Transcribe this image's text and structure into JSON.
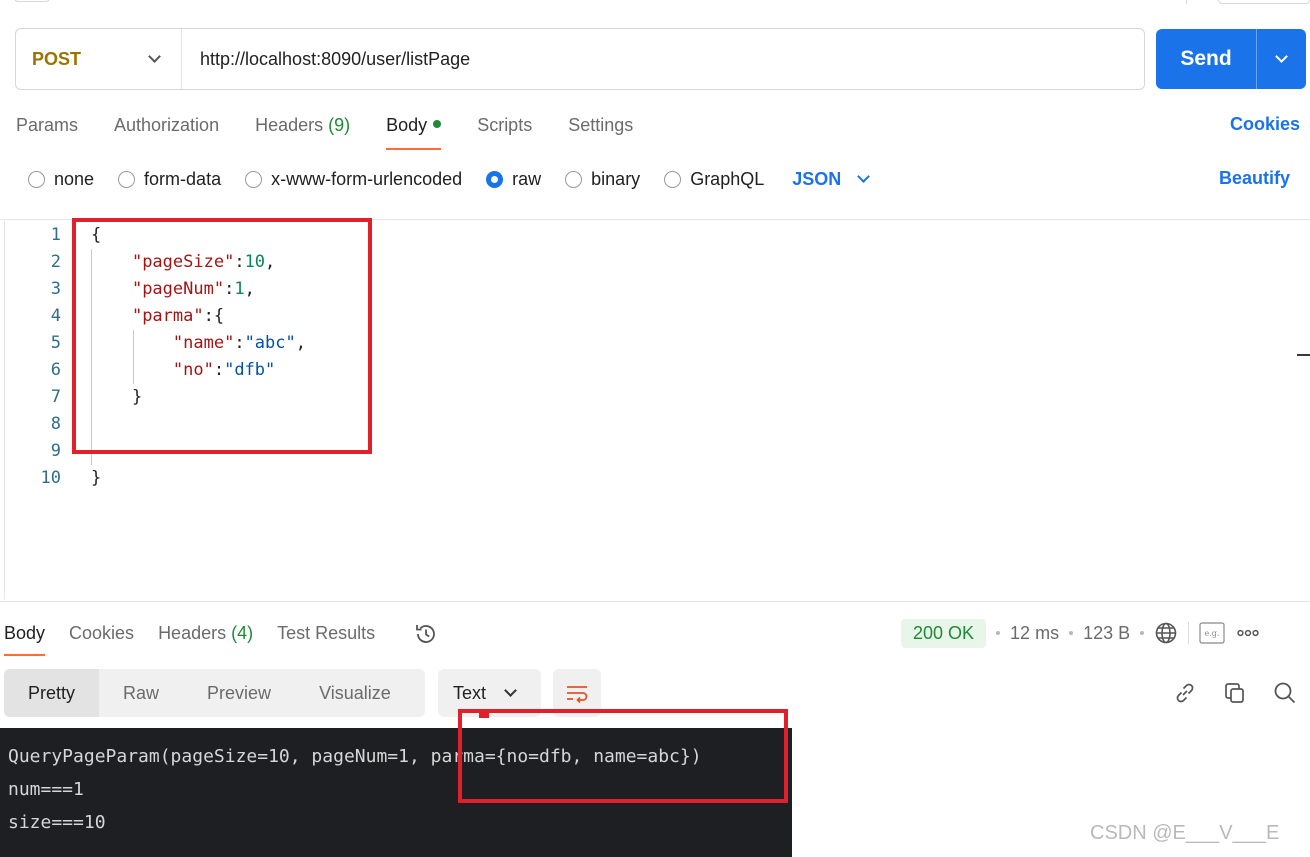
{
  "request": {
    "method": "POST",
    "url": "http://localhost:8090/user/listPage",
    "send_label": "Send"
  },
  "request_tabs": [
    {
      "label": "Params"
    },
    {
      "label": "Authorization"
    },
    {
      "label": "Headers",
      "count": "(9)"
    },
    {
      "label": "Body",
      "active": true,
      "indicator": "dot"
    },
    {
      "label": "Scripts"
    },
    {
      "label": "Settings"
    }
  ],
  "cookies_link": "Cookies",
  "body_types": {
    "options": [
      "none",
      "form-data",
      "x-www-form-urlencoded",
      "raw",
      "binary",
      "GraphQL"
    ],
    "selected": "raw",
    "format": "JSON",
    "beautify_label": "Beautify"
  },
  "editor": {
    "line_numbers": [
      "1",
      "2",
      "3",
      "4",
      "5",
      "6",
      "7",
      "8",
      "9",
      "10"
    ],
    "lines": [
      "{",
      "    \"pageSize\":10,",
      "    \"pageNum\":1,",
      "    \"parma\":{",
      "        \"name\":\"abc\",",
      "        \"no\":\"dfb\"",
      "    }",
      "",
      "",
      "}"
    ],
    "tokens": {
      "l1_brace": "{",
      "l2_key": "\"pageSize\"",
      "l2_colon": ":",
      "l2_val": "10",
      "l2_comma": ",",
      "l3_key": "\"pageNum\"",
      "l3_colon": ":",
      "l3_val": "1",
      "l3_comma": ",",
      "l4_key": "\"parma\"",
      "l4_rest": ":{",
      "l5_key": "\"name\"",
      "l5_colon": ":",
      "l5_val": "\"abc\"",
      "l5_comma": ",",
      "l6_key": "\"no\"",
      "l6_colon": ":",
      "l6_val": "\"dfb\"",
      "l7_brace": "}",
      "l10_brace": "}"
    }
  },
  "response_tabs": [
    {
      "label": "Body",
      "active": true
    },
    {
      "label": "Cookies"
    },
    {
      "label": "Headers",
      "count": "(4)"
    },
    {
      "label": "Test Results"
    }
  ],
  "response_meta": {
    "status": "200 OK",
    "time": "12 ms",
    "size": "123 B",
    "status_color": "#1f8a36"
  },
  "view_modes": [
    "Pretty",
    "Raw",
    "Preview",
    "Visualize"
  ],
  "view_selected": "Pretty",
  "text_format": "Text",
  "console": {
    "lines": [
      "QueryPageParam(pageSize=10, pageNum=1, parma={no=dfb, name=abc})",
      "num===1",
      "size===10"
    ]
  },
  "watermark": "CSDN @E___V___E",
  "colors": {
    "accent": "#1a73e8",
    "method": "#9a7400",
    "tab_underline": "#ff6c37",
    "highlight_box": "#e0202a",
    "console_bg": "#1e1f22"
  },
  "icons": [
    "chevron-down-icon",
    "history-icon",
    "globe-icon",
    "example-icon",
    "more-icon",
    "wrap-lines-icon",
    "link-icon",
    "copy-icon",
    "search-icon"
  ]
}
